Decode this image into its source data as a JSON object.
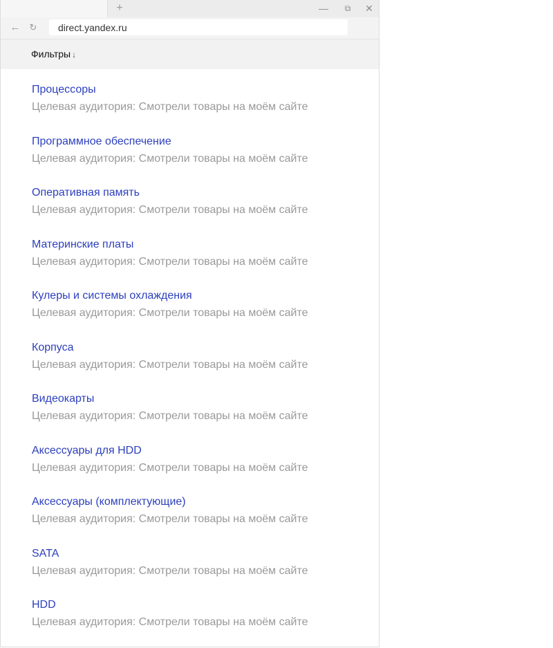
{
  "browser": {
    "new_tab": "+",
    "url": "direct.yandex.ru",
    "back": "←",
    "reload": "↻",
    "minimize": "—",
    "maximize": "⧉",
    "close": "✕"
  },
  "header": {
    "filters_label": "Фильтры",
    "filters_arrow": "↓"
  },
  "items": [
    {
      "title": "Процессоры",
      "subtitle": "Целевая аудитория: Смотрели товары на моём сайте"
    },
    {
      "title": "Программное обеспечение",
      "subtitle": "Целевая аудитория: Смотрели товары на моём сайте"
    },
    {
      "title": "Оперативная память",
      "subtitle": "Целевая аудитория: Смотрели товары на моём сайте"
    },
    {
      "title": "Материнские платы",
      "subtitle": "Целевая аудитория: Смотрели товары на моём сайте"
    },
    {
      "title": "Кулеры и системы охлаждения",
      "subtitle": "Целевая аудитория: Смотрели товары на моём сайте"
    },
    {
      "title": "Корпуса",
      "subtitle": "Целевая аудитория: Смотрели товары на моём сайте"
    },
    {
      "title": "Видеокарты",
      "subtitle": "Целевая аудитория: Смотрели товары на моём сайте"
    },
    {
      "title": "Аксессуары для HDD",
      "subtitle": "Целевая аудитория: Смотрели товары на моём сайте"
    },
    {
      "title": "Аксессуары (комплектующие)",
      "subtitle": "Целевая аудитория: Смотрели товары на моём сайте"
    },
    {
      "title": "SATA",
      "subtitle": "Целевая аудитория: Смотрели товары на моём сайте"
    },
    {
      "title": "HDD",
      "subtitle": "Целевая аудитория: Смотрели товары на моём сайте"
    }
  ]
}
